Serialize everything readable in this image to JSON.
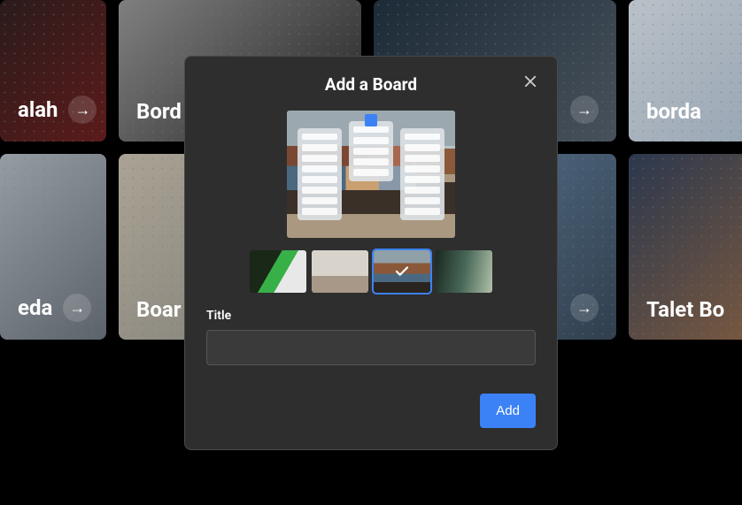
{
  "background_boards": {
    "row1": [
      {
        "label": "alah"
      },
      {
        "label": "Bord"
      },
      {
        "label": ""
      },
      {
        "label": "borda"
      }
    ],
    "row2": [
      {
        "label": "eda"
      },
      {
        "label": "Boar"
      },
      {
        "label": ""
      },
      {
        "label": "Talet Bo"
      }
    ]
  },
  "modal": {
    "title": "Add a Board",
    "title_field_label": "Title",
    "title_value": "",
    "add_button": "Add",
    "backgrounds": [
      {
        "name": "bg-option-1",
        "selected": false
      },
      {
        "name": "bg-option-2",
        "selected": false
      },
      {
        "name": "bg-option-3",
        "selected": true
      },
      {
        "name": "bg-option-4",
        "selected": false
      }
    ]
  },
  "icons": {
    "close": "close-icon",
    "arrow": "arrow-right-icon",
    "check": "check-icon"
  }
}
